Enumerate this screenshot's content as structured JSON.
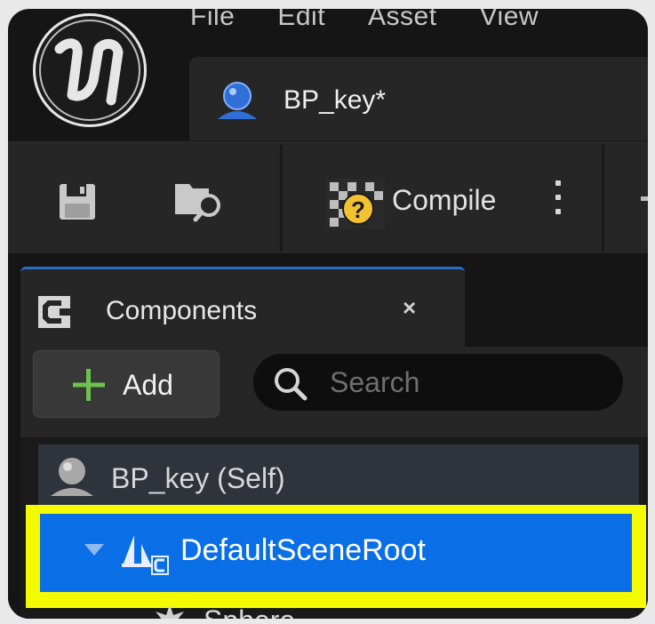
{
  "menu": {
    "items": [
      "File",
      "Edit",
      "Asset",
      "View"
    ]
  },
  "asset_tab": {
    "label": "BP_key*"
  },
  "toolbar": {
    "compile_label": "Compile"
  },
  "components_panel": {
    "title": "Components",
    "close_label": "×",
    "add_label": "Add",
    "search_placeholder": "Search",
    "tree": {
      "self_row": "BP_key (Self)",
      "root_row": "DefaultSceneRoot",
      "child_row": "Sphere"
    }
  },
  "colors": {
    "selection": "#0a6fe6",
    "highlight": "#f4fb00",
    "add_plus": "#6cc24a",
    "compile_badge": "#f2c230",
    "tab_accent": "#2b6ac7"
  }
}
